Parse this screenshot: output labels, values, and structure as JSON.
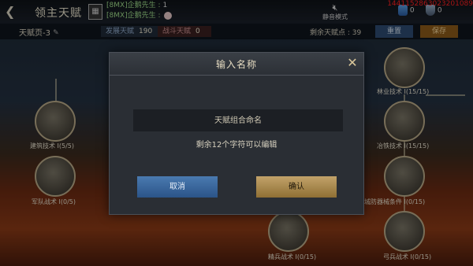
{
  "header": {
    "title": "领主天赋",
    "chat": [
      {
        "prefix": "[8MX]企鹅先生 : ",
        "text": "1"
      },
      {
        "prefix": "[8MX]企鹅先生 : ",
        "text": ""
      }
    ],
    "mute_label": "静音模式",
    "resource_1": "0",
    "resource_2": "0",
    "debug_id": "1441152863023201089"
  },
  "toolbar": {
    "talent_page": "天赋页-3",
    "tab_dev_label": "发展天赋",
    "tab_dev_value": "190",
    "tab_combat_label": "战斗天赋",
    "tab_combat_value": "0",
    "remaining_label": "剩余天赋点 :",
    "remaining_value": "39",
    "reset_label": "重置",
    "save_label": "保存"
  },
  "nodes": [
    {
      "label": "林业技术 I(15/15)"
    },
    {
      "label": "建筑技术 I(5/5)"
    },
    {
      "label": "冶铁技术 I(15/15)"
    },
    {
      "label": "军队战术 I(0/5)"
    },
    {
      "label": "城防器械条件 I(0/15)"
    },
    {
      "label": "精兵战术 I(0/15)"
    },
    {
      "label": "弓兵战术 I(0/15)"
    }
  ],
  "dialog": {
    "title": "输入名称",
    "input_placeholder": "天赋组合命名",
    "remaining_text": "剩余12个字符可以编辑",
    "cancel_label": "取消",
    "confirm_label": "确认"
  },
  "colors": {
    "cancel": "#3a6aa0",
    "confirm": "#b8955a"
  }
}
